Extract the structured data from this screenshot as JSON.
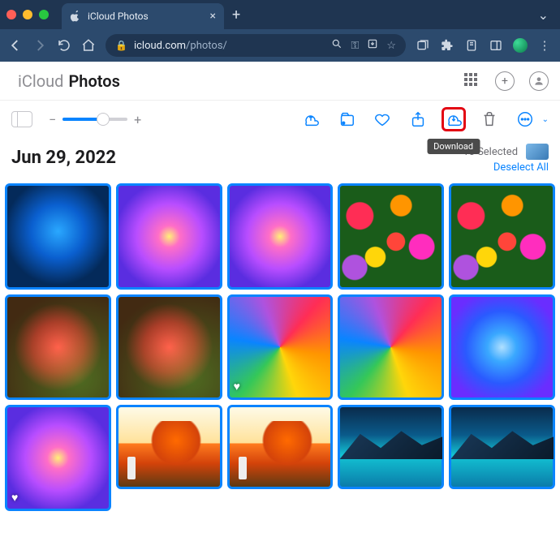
{
  "browser": {
    "tab_title": "iCloud Photos",
    "url_host": "icloud.com",
    "url_path": "/photos/"
  },
  "app": {
    "brand_prefix": "iCloud",
    "brand_main": "Photos"
  },
  "toolbar": {
    "download_tooltip": "Download"
  },
  "selection": {
    "date": "Jun 29, 2022",
    "count_text": "15 Selected",
    "deselect_label": "Deselect All"
  },
  "photos": [
    {
      "id": "blue-rose",
      "selected": true,
      "class": "p-bluerose"
    },
    {
      "id": "pink-dahlia-1",
      "selected": true,
      "class": "p-dahlia"
    },
    {
      "id": "pink-dahlia-2",
      "selected": true,
      "class": "p-dahlia"
    },
    {
      "id": "mixed-flowers-1",
      "selected": true,
      "class": "p-mixed"
    },
    {
      "id": "mixed-flowers-2",
      "selected": true,
      "class": "p-mixed"
    },
    {
      "id": "red-rose-1",
      "selected": true,
      "class": "p-redrose"
    },
    {
      "id": "red-rose-2",
      "selected": true,
      "class": "p-redrose"
    },
    {
      "id": "rainbow-rose-1",
      "selected": true,
      "class": "p-rainbowrose",
      "favorite": true
    },
    {
      "id": "rainbow-rose-2",
      "selected": true,
      "class": "p-rainbowrose"
    },
    {
      "id": "blue-dahlia",
      "selected": true,
      "class": "p-bluedahlia"
    },
    {
      "id": "pink-dahlia-3",
      "selected": true,
      "class": "p-dahlia",
      "favorite": true,
      "landscape": false
    },
    {
      "id": "autumn-tree-1",
      "selected": true,
      "class": "p-autumntree",
      "landscape": true
    },
    {
      "id": "autumn-tree-2",
      "selected": true,
      "class": "p-autumntree",
      "landscape": true
    },
    {
      "id": "mountain-lake-1",
      "selected": true,
      "class": "p-mountain",
      "landscape": true
    },
    {
      "id": "mountain-lake-2",
      "selected": true,
      "class": "p-mountain",
      "landscape": true
    }
  ]
}
